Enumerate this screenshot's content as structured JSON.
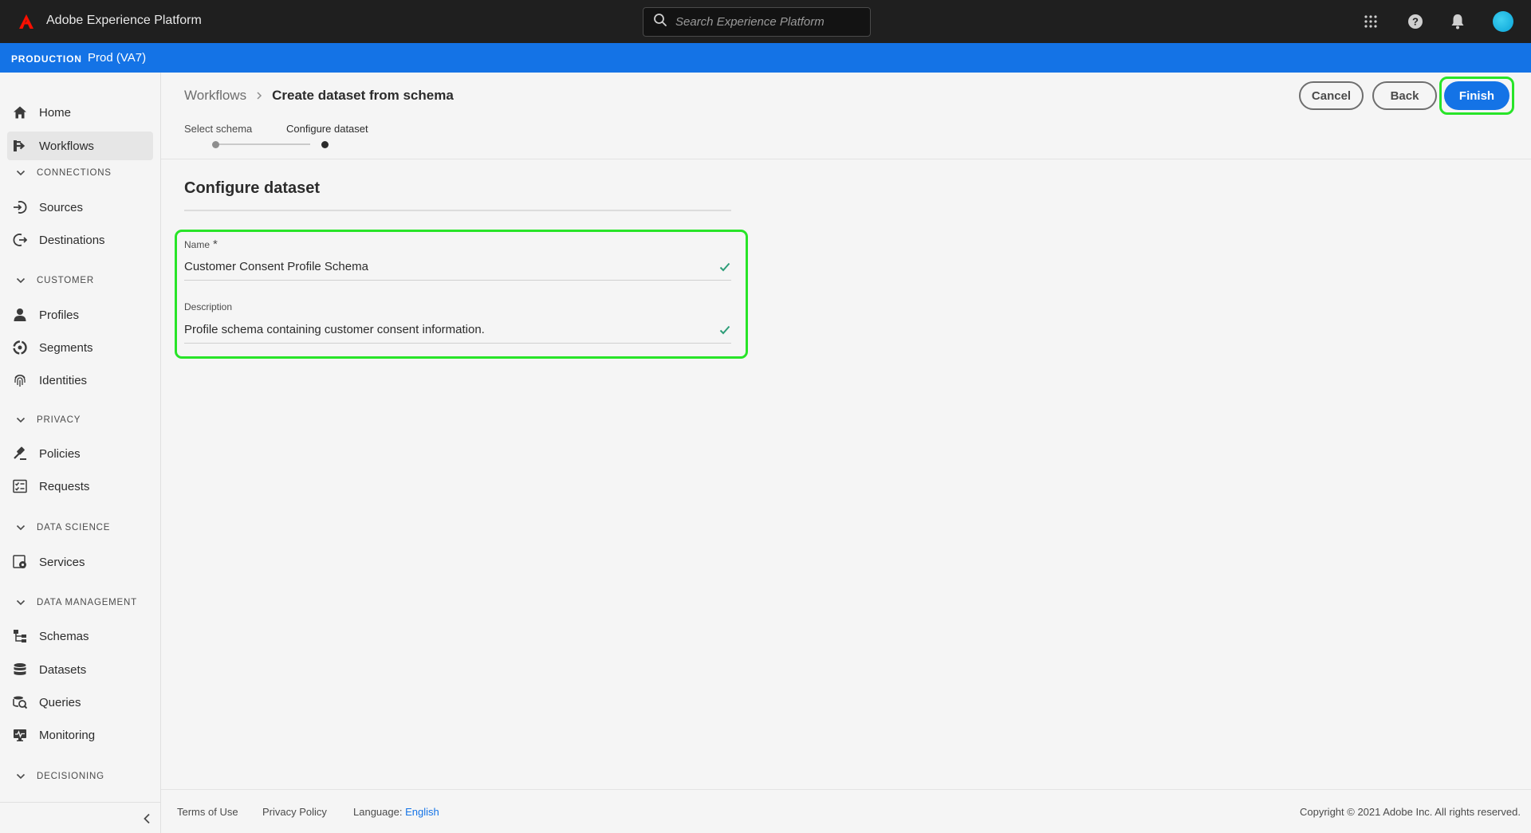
{
  "header": {
    "app_title": "Adobe Experience Platform",
    "search_placeholder": "Search Experience Platform",
    "logo_icon": "adobe-logo-icon",
    "icons": [
      "apps-grid-icon",
      "help-icon",
      "notifications-bell-icon",
      "user-avatar"
    ]
  },
  "environment": {
    "label": "PRODUCTION",
    "sandbox": "Prod (VA7)",
    "color": "#1473e6"
  },
  "sidebar": {
    "items": [
      {
        "label": "Home",
        "icon": "home-icon"
      },
      {
        "label": "Workflows",
        "icon": "workflows-icon",
        "active": true
      }
    ],
    "sections": [
      {
        "title": "CONNECTIONS",
        "items": [
          {
            "label": "Sources",
            "icon": "sources-icon"
          },
          {
            "label": "Destinations",
            "icon": "destinations-icon"
          }
        ]
      },
      {
        "title": "CUSTOMER",
        "items": [
          {
            "label": "Profiles",
            "icon": "profile-icon"
          },
          {
            "label": "Segments",
            "icon": "segments-icon"
          },
          {
            "label": "Identities",
            "icon": "fingerprint-icon"
          }
        ]
      },
      {
        "title": "PRIVACY",
        "items": [
          {
            "label": "Policies",
            "icon": "gavel-icon"
          },
          {
            "label": "Requests",
            "icon": "checklist-icon"
          }
        ]
      },
      {
        "title": "DATA SCIENCE",
        "items": [
          {
            "label": "Services",
            "icon": "services-gear-icon"
          }
        ]
      },
      {
        "title": "DATA MANAGEMENT",
        "items": [
          {
            "label": "Schemas",
            "icon": "schema-icon"
          },
          {
            "label": "Datasets",
            "icon": "database-icon"
          },
          {
            "label": "Queries",
            "icon": "query-icon"
          },
          {
            "label": "Monitoring",
            "icon": "monitoring-icon"
          }
        ]
      },
      {
        "title": "DECISIONING",
        "items": []
      }
    ]
  },
  "breadcrumb": {
    "parent": "Workflows",
    "current": "Create dataset from schema"
  },
  "actions": {
    "cancel": "Cancel",
    "back": "Back",
    "finish": "Finish"
  },
  "steps": [
    {
      "label": "Select schema",
      "state": "complete"
    },
    {
      "label": "Configure dataset",
      "state": "current"
    }
  ],
  "form": {
    "title": "Configure dataset",
    "name_label": "Name",
    "name_required": "*",
    "name_value": "Customer Consent Profile Schema",
    "description_label": "Description",
    "description_value": "Profile schema containing customer consent information.",
    "valid_color": "#2d9d78"
  },
  "footer": {
    "terms": "Terms of Use",
    "privacy": "Privacy Policy",
    "language_label": "Language:",
    "language_value": "English",
    "copyright": "Copyright ©  2021 Adobe Inc.  All rights reserved."
  }
}
